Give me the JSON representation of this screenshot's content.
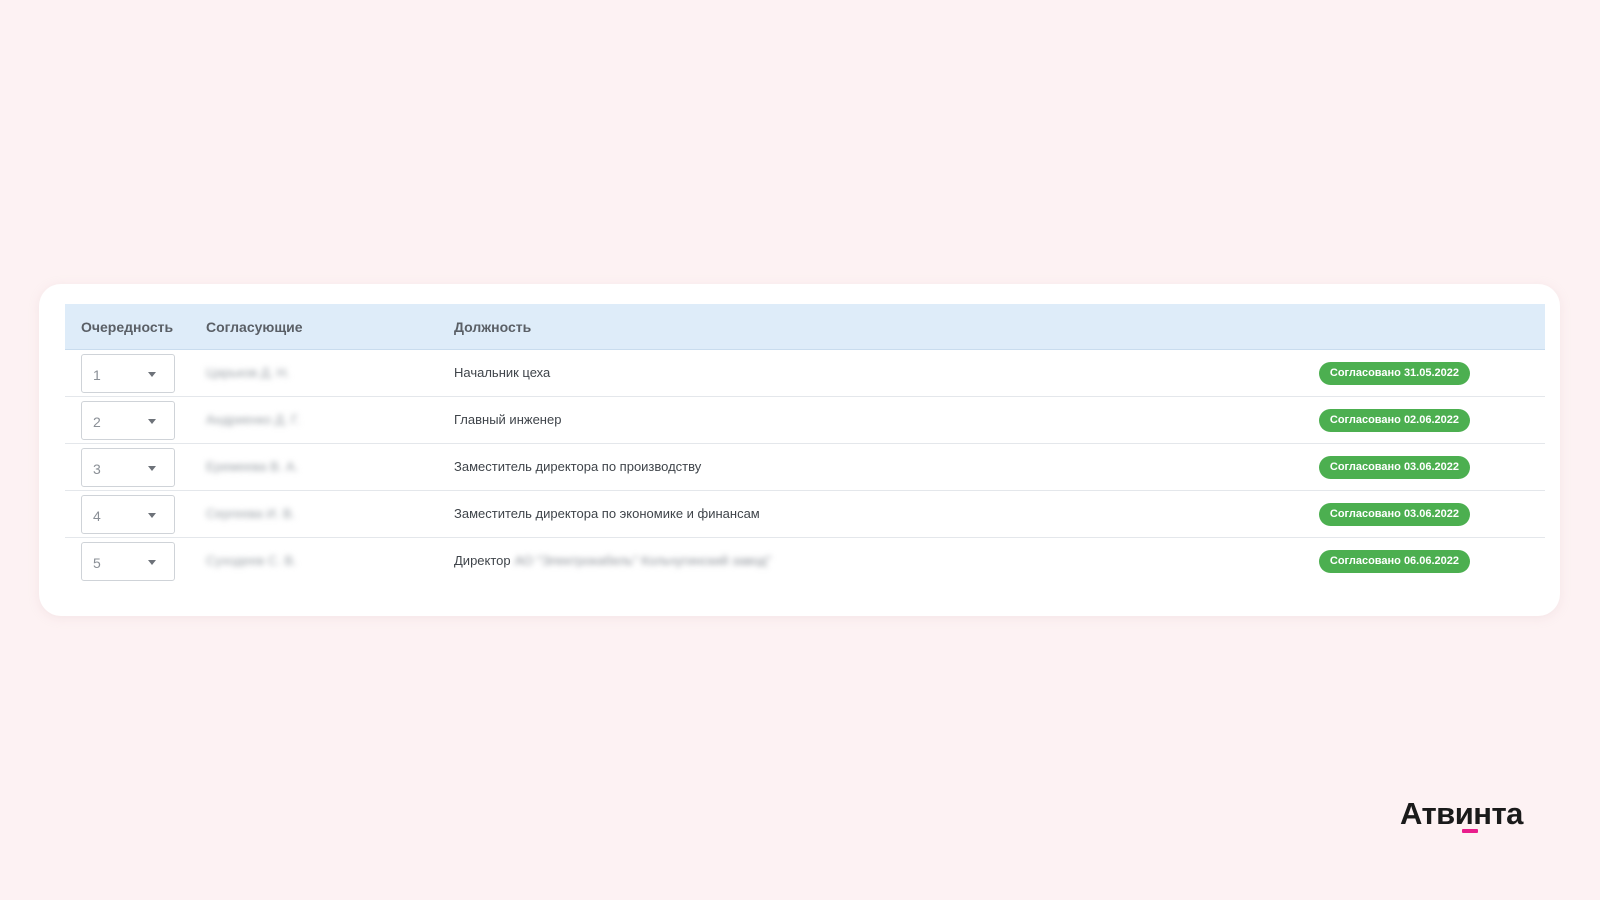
{
  "table": {
    "headers": {
      "order": "Очередность",
      "approver": "Согласующие",
      "position": "Должность"
    },
    "rows": [
      {
        "order": "1",
        "approver": "Царьков Д. Н.",
        "position": "Начальник цеха",
        "position_extra": "",
        "status": "Согласовано 31.05.2022"
      },
      {
        "order": "2",
        "approver": "Андриенко Д. Г.",
        "position": "Главный инженер",
        "position_extra": "",
        "status": "Согласовано 02.06.2022"
      },
      {
        "order": "3",
        "approver": "Еремеева В. А.",
        "position": "Заместитель директора по производству",
        "position_extra": "",
        "status": "Согласовано 03.06.2022"
      },
      {
        "order": "4",
        "approver": "Сергеева И. В.",
        "position": "Заместитель директора по экономике и финансам",
        "position_extra": "",
        "status": "Согласовано 03.06.2022"
      },
      {
        "order": "5",
        "approver": "Суходеев С. В.",
        "position": "Директор",
        "position_extra": "АО \"Электрокабель\" Кольчугинский завод\"",
        "status": "Согласовано 06.06.2022"
      }
    ]
  },
  "brand": {
    "logo_text": "Атвинта",
    "accent_color": "#e91e8c"
  },
  "colors": {
    "status_green": "#4caf50",
    "header_bg": "#deecf9",
    "page_bg": "#fdf2f3"
  }
}
